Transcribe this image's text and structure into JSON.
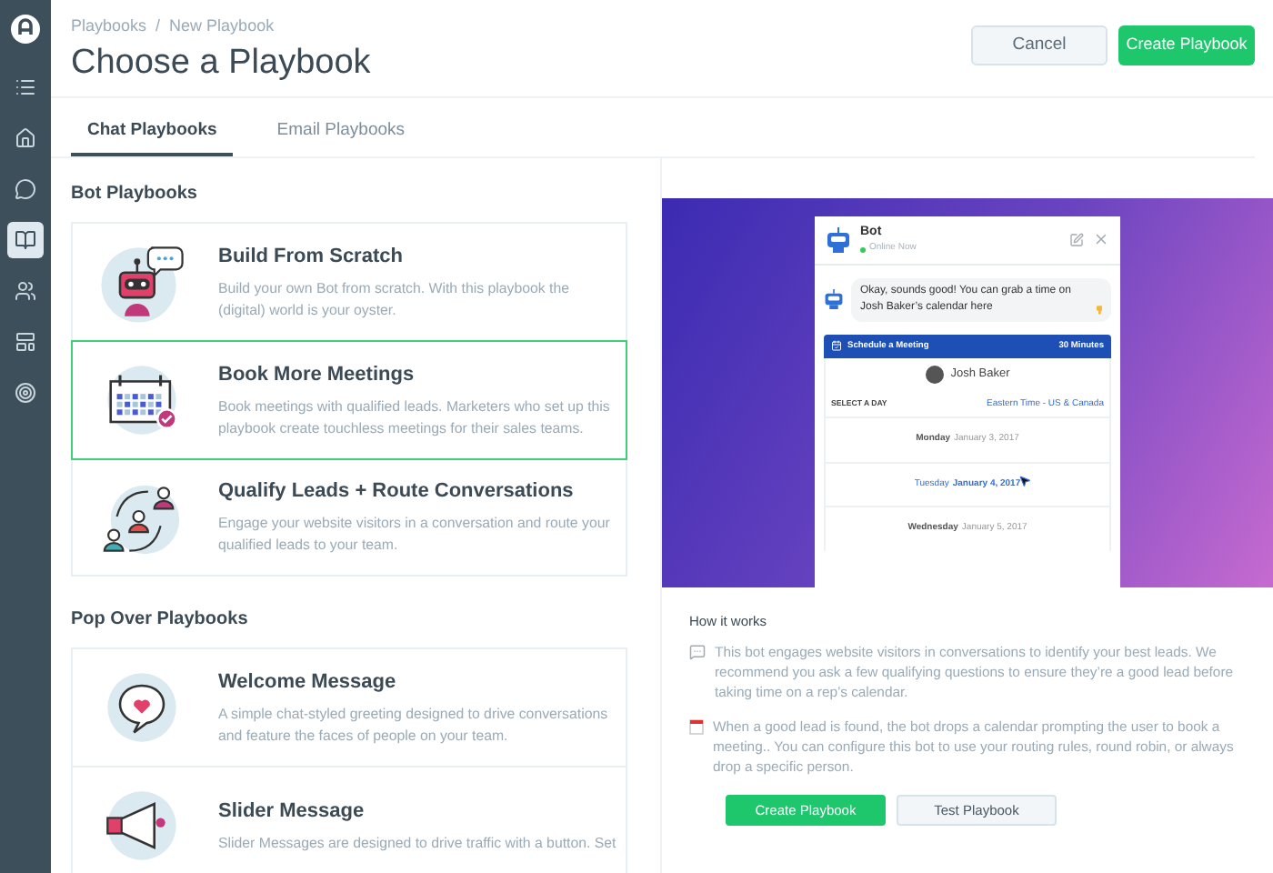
{
  "sidebar": {
    "items": [
      {
        "selected": false
      },
      {
        "selected": false
      },
      {
        "selected": false
      },
      {
        "selected": true
      },
      {
        "selected": false
      },
      {
        "selected": false
      },
      {
        "selected": false
      }
    ]
  },
  "breadcrumb": [
    "Playbooks",
    "New Playbook"
  ],
  "breadcrumb_separator": "/",
  "title": "Choose a Playbook",
  "header_buttons": {
    "cancel": "Cancel",
    "create": "Create Playbook"
  },
  "tabs": [
    {
      "label": "Chat Playbooks",
      "selected": true
    },
    {
      "label": "Email Playbooks",
      "selected": false
    }
  ],
  "sections": [
    {
      "heading": "Bot Playbooks",
      "playbooks": [
        {
          "name": "Build From Scratch",
          "description": "Build your own Bot from scratch. With this playbook the (digital) world is your oyster.",
          "selected": false
        },
        {
          "name": "Book More Meetings",
          "description": "Book meetings with qualified leads. Marketers who set up this playbook create touchless meetings for their sales teams.",
          "selected": true
        },
        {
          "name": "Qualify Leads + Route Conversations",
          "description": "Engage your website visitors in a conversation and route your qualified leads to your team.",
          "selected": false
        }
      ]
    },
    {
      "heading": "Pop Over Playbooks",
      "playbooks": [
        {
          "name": "Welcome Message",
          "description": "A simple chat-styled greeting designed to drive conversations and feature the faces of people on your team.",
          "selected": false
        },
        {
          "name": "Slider Message",
          "description": "Slider Messages are designed to drive traffic with a button. Set",
          "selected": false
        }
      ]
    }
  ],
  "preview": {
    "bot_name": "Bot",
    "status": "Online Now",
    "message": "Okay, sounds good! You can grab a time on Josh Baker’s calendar here",
    "schedule_title": "Schedule a Meeting",
    "duration": "30 Minutes",
    "person": "Josh Baker",
    "select_label": "SELECT A DAY",
    "timezone": "Eastern Time - US & Canada",
    "days": [
      {
        "weekday": "Monday",
        "date": "January 3, 2017",
        "selected": false
      },
      {
        "weekday": "Tuesday",
        "date": "January 4, 2017",
        "selected": true
      },
      {
        "weekday": "Wednesday",
        "date": "January 5, 2017",
        "selected": false
      }
    ]
  },
  "how_it_works": {
    "heading": "How it works",
    "items": [
      "This bot engages website visitors in conversations to identify your best leads. We recommend you ask a few qualifying questions to ensure they’re a good lead before taking time on a rep’s calendar.",
      "When a good lead is found, the bot drops a calendar prompting the user to book a meeting.. You can configure this bot to use your routing rules, round robin, or always drop a specific person."
    ],
    "buttons": {
      "create": "Create Playbook",
      "test": "Test Playbook"
    }
  }
}
